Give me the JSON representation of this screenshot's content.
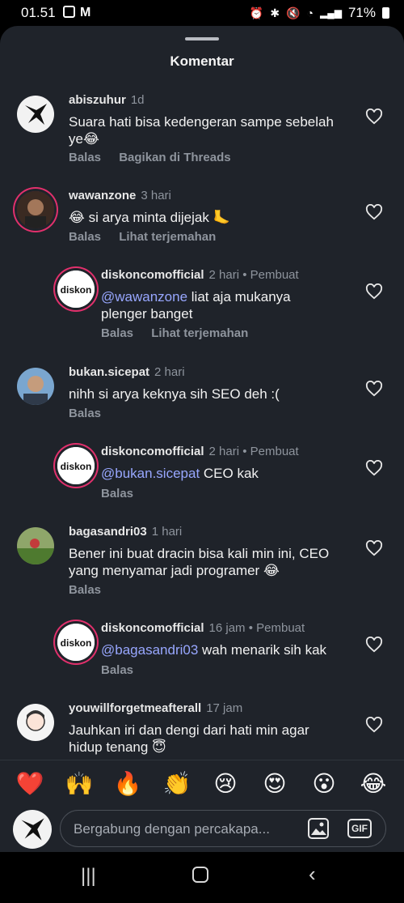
{
  "status_bar": {
    "time": "01.51",
    "battery": "71%"
  },
  "sheet": {
    "title": "Komentar"
  },
  "comments": [
    {
      "username": "abiszuhur",
      "time": "1d",
      "text": "Suara hati bisa kedengeran sampe sebelah ye😂",
      "actions": [
        "Balas",
        "Bagikan di Threads"
      ]
    },
    {
      "username": "wawanzone",
      "time": "3 hari",
      "text": "😂 si arya minta dijejak 🦶",
      "actions": [
        "Balas",
        "Lihat terjemahan"
      ]
    },
    {
      "username": "diskoncomofficial",
      "time": "2 hari",
      "creator": "• Pembuat",
      "mention": "@wawanzone",
      "text": " liat aja mukanya plenger banget",
      "actions": [
        "Balas",
        "Lihat terjemahan"
      ]
    },
    {
      "username": "bukan.sicepat",
      "time": "2 hari",
      "text": "nihh si arya keknya sih SEO deh :(",
      "actions": [
        "Balas"
      ]
    },
    {
      "username": "diskoncomofficial",
      "time": "2 hari",
      "creator": "• Pembuat",
      "mention": "@bukan.sicepat",
      "text": " CEO kak",
      "actions": [
        "Balas"
      ]
    },
    {
      "username": "bagasandri03",
      "time": "1 hari",
      "text": "Bener ini buat dracin bisa kali min ini, CEO yang menyamar jadi programer 😂",
      "actions": [
        "Balas"
      ]
    },
    {
      "username": "diskoncomofficial",
      "time": "16 jam",
      "creator": "• Pembuat",
      "mention": "@bagasandri03",
      "text": " wah menarik sih kak",
      "actions": [
        "Balas"
      ]
    },
    {
      "username": "youwillforgetmeafterall",
      "time": "17 jam",
      "text": "Jauhkan iri dan dengi dari hati min agar hidup tenang 😇",
      "actions": []
    }
  ],
  "reactions": [
    "❤️",
    "🙌",
    "🔥",
    "👏",
    "😢",
    "😍",
    "😮",
    "😂"
  ],
  "composer": {
    "placeholder": "Bergabung dengan percakapa...",
    "gif_label": "GIF"
  },
  "brand_logo_text": "diskon"
}
